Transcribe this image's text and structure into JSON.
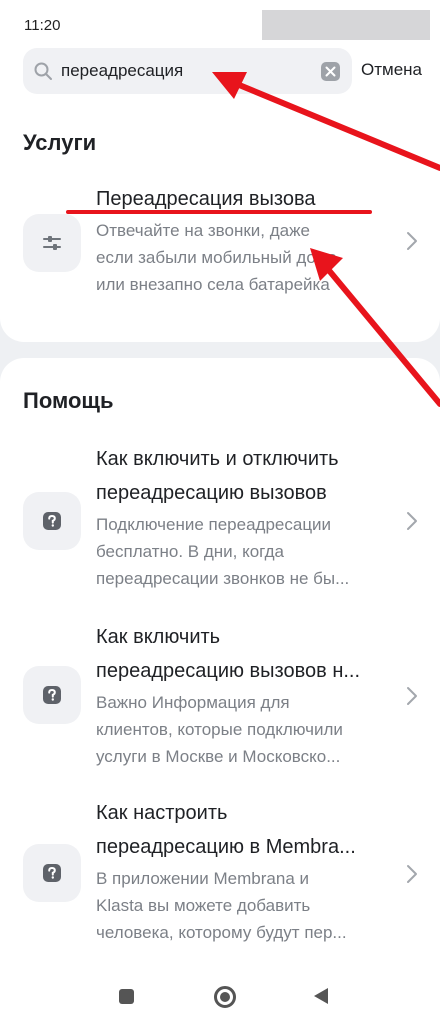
{
  "status_bar": {
    "time": "11:20"
  },
  "search": {
    "query": "переадресация",
    "cancel_label": "Отмена"
  },
  "services": {
    "section_title": "Услуги",
    "items": [
      {
        "title": "Переадресация вызова",
        "description": [
          "Отвечайте на звонки, даже",
          "если забыли мобильный дома",
          "или внезапно села батарейка"
        ],
        "icon": "sliders-icon"
      }
    ]
  },
  "help": {
    "section_title": "Помощь",
    "items": [
      {
        "title": [
          "Как включить и отключить",
          "переадресацию вызовов"
        ],
        "description": [
          "Подключение переадресации",
          "бесплатно. В дни, когда",
          "переадресации звонков не бы..."
        ],
        "icon": "question-icon"
      },
      {
        "title": [
          "Как включить",
          "переадресацию вызовов н..."
        ],
        "description": [
          "Важно Информация для",
          "клиентов, которые подключили",
          "услуги в Москве и Московско..."
        ],
        "icon": "question-icon"
      },
      {
        "title": [
          "Как настроить",
          "переадресацию в Membra..."
        ],
        "description": [
          "В приложении Membrana и",
          "Klasta вы можете добавить",
          "человека, которому будут пер..."
        ],
        "icon": "question-icon"
      }
    ]
  },
  "colors": {
    "annotation_red": "#e8141c",
    "secondary_text": "#7c8087",
    "icon_bg": "#f0f1f4"
  }
}
